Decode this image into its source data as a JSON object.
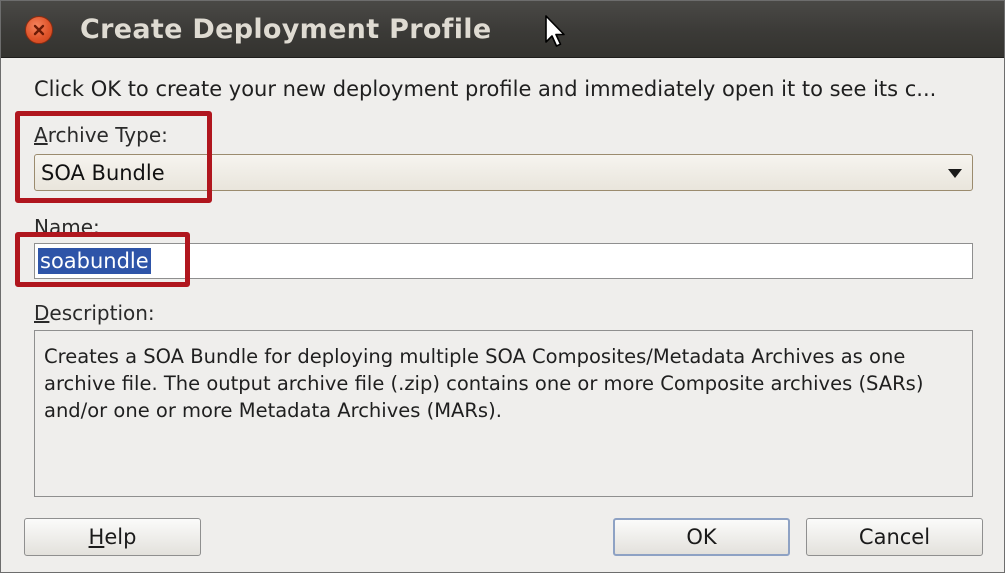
{
  "window": {
    "title": "Create Deployment Profile"
  },
  "instruction": "Click OK to create your new deployment profile and immediately open it to see its c...",
  "archive_type": {
    "label_mnemonic": "A",
    "label_rest": "rchive Type:",
    "value": "SOA Bundle"
  },
  "name_field": {
    "label_mnemonic": "N",
    "label_rest": "ame:",
    "value": "soabundle"
  },
  "description": {
    "label_mnemonic": "D",
    "label_rest": "escription:",
    "text": "Creates a SOA Bundle for deploying multiple SOA Composites/Metadata Archives as one archive file. The output archive file (.zip) contains one or more Composite archives (SARs) and/or one or more Metadata Archives (MARs)."
  },
  "buttons": {
    "help_mnemonic": "H",
    "help_rest": "elp",
    "ok": "OK",
    "cancel": "Cancel"
  },
  "colors": {
    "highlight_border": "#b0161e",
    "selection": "#2e54a8",
    "titlebar": "#3b3a37",
    "close_button": "#e0552b"
  },
  "icons": {
    "close": "close-icon",
    "dropdown": "triangle-down-icon",
    "cursor": "mouse-pointer-icon"
  }
}
